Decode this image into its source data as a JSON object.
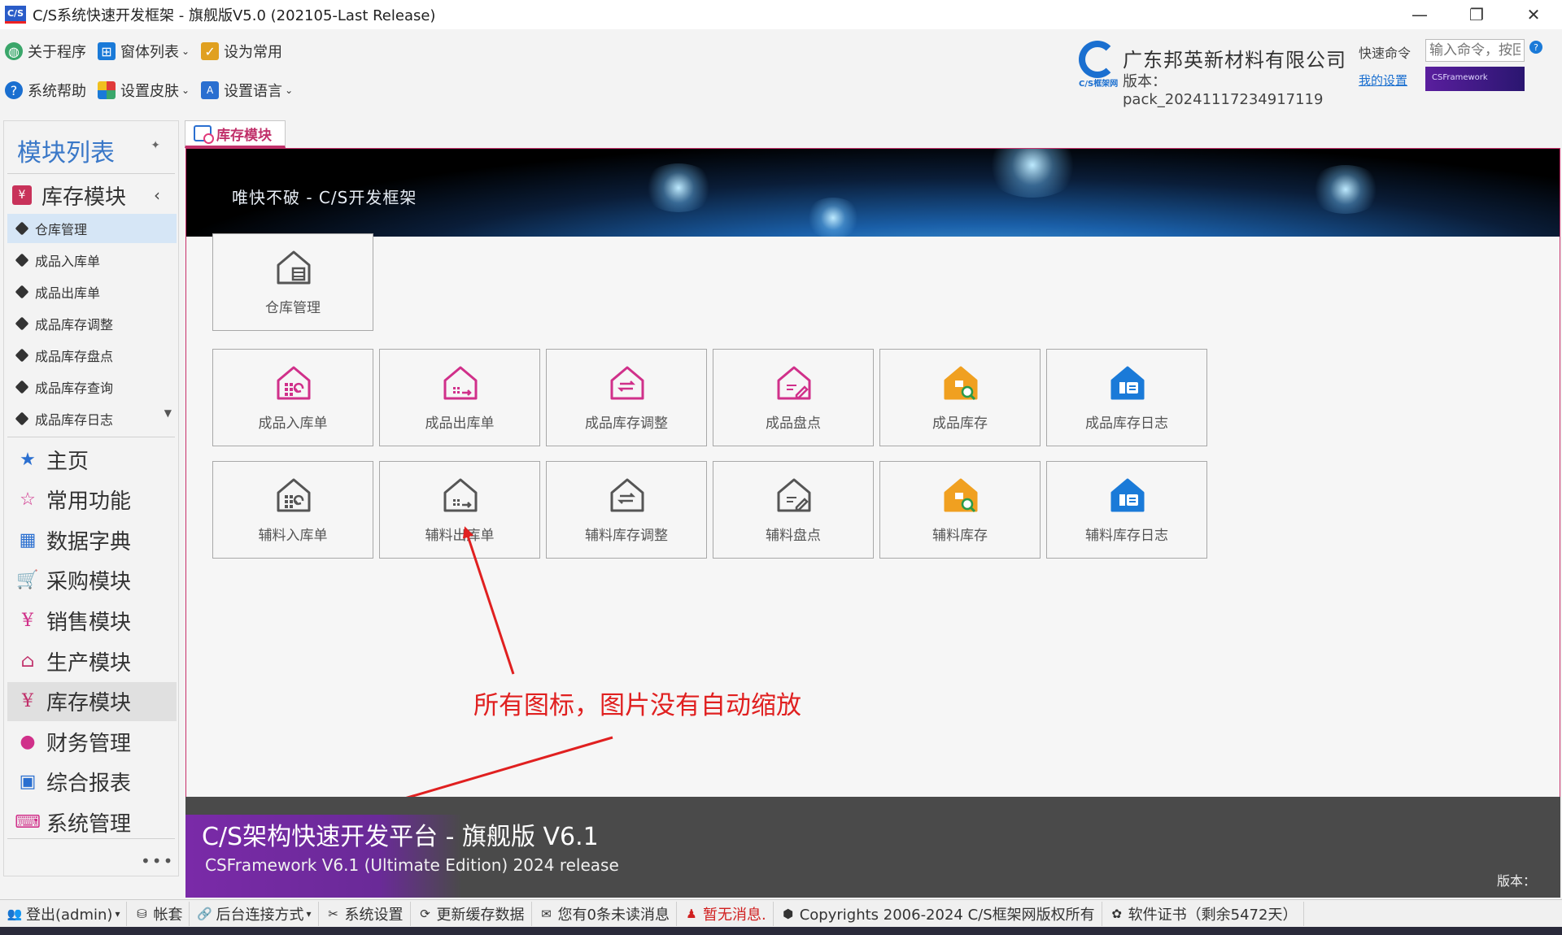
{
  "window": {
    "logo_text": "C/S",
    "title": "C/S系统快速开发框架 - 旗舰版V5.0 (202105-Last Release)",
    "buttons": [
      "—",
      "❐",
      "✕"
    ]
  },
  "toolbar": {
    "row1": [
      {
        "label": "关于程序",
        "icon": "globe-icon",
        "dropdown": false
      },
      {
        "label": "窗体列表",
        "icon": "windows-icon",
        "dropdown": true
      },
      {
        "label": "设为常用",
        "icon": "clipboard-icon",
        "dropdown": false
      }
    ],
    "row2": [
      {
        "label": "系统帮助",
        "icon": "help-icon",
        "dropdown": false
      },
      {
        "label": "设置皮肤",
        "icon": "palette-icon",
        "dropdown": true
      },
      {
        "label": "设置语言",
        "icon": "language-icon",
        "dropdown": true
      }
    ]
  },
  "company": {
    "logo_sub": "C/S框架网",
    "name": "广东邦英新材料有限公司",
    "version": "版本：pack_20241117234917119"
  },
  "quick": {
    "label": "快速命令",
    "placeholder": "输入命令，按回",
    "help": "?",
    "my_settings": "我的设置",
    "badge": "CSFramework"
  },
  "sidebar": {
    "title": "模块列表",
    "pin": "✦",
    "group": {
      "label": "库存模块",
      "arrow": "‹"
    },
    "sub_items": [
      {
        "label": "仓库管理",
        "active": true
      },
      {
        "label": "成品入库单",
        "active": false
      },
      {
        "label": "成品出库单",
        "active": false
      },
      {
        "label": "成品库存调整",
        "active": false
      },
      {
        "label": "成品库存盘点",
        "active": false
      },
      {
        "label": "成品库存查询",
        "active": false
      },
      {
        "label": "成品库存日志",
        "active": false
      }
    ],
    "modules": [
      {
        "label": "主页",
        "icon": "star-filled-icon",
        "glyph": "★",
        "color": "#2a6fd0",
        "active": false
      },
      {
        "label": "常用功能",
        "icon": "star-outline-icon",
        "glyph": "☆",
        "color": "#d0308a",
        "active": false
      },
      {
        "label": "数据字典",
        "icon": "dictionary-icon",
        "glyph": "▦",
        "color": "#2a6fd0",
        "active": false
      },
      {
        "label": "采购模块",
        "icon": "cart-icon",
        "glyph": "🛒",
        "color": "#d0308a",
        "active": false
      },
      {
        "label": "销售模块",
        "icon": "bag-icon",
        "glyph": "¥",
        "color": "#d0308a",
        "active": false
      },
      {
        "label": "生产模块",
        "icon": "factory-icon",
        "glyph": "⌂",
        "color": "#c0306a",
        "active": false
      },
      {
        "label": "库存模块",
        "icon": "inventory-icon",
        "glyph": "¥",
        "color": "#c0306a",
        "active": true
      },
      {
        "label": "财务管理",
        "icon": "user-icon",
        "glyph": "●",
        "color": "#d0308a",
        "active": false
      },
      {
        "label": "综合报表",
        "icon": "report-icon",
        "glyph": "▣",
        "color": "#2a6fd0",
        "active": false
      },
      {
        "label": "系统管理",
        "icon": "code-icon",
        "glyph": "⌨",
        "color": "#d0308a",
        "active": false
      }
    ],
    "more": "•••"
  },
  "tab": {
    "label": "库存模块"
  },
  "banner": {
    "text": "唯快不破 - C/S开发框架"
  },
  "tiles_row1": [
    {
      "label": "仓库管理",
      "icon": "warehouse-list-icon",
      "color": "#555555"
    }
  ],
  "tiles_row2": [
    {
      "label": "成品入库单",
      "icon": "warehouse-in-icon",
      "color": "#d0308a"
    },
    {
      "label": "成品出库单",
      "icon": "warehouse-out-icon",
      "color": "#d0308a"
    },
    {
      "label": "成品库存调整",
      "icon": "warehouse-adjust-icon",
      "color": "#d0308a"
    },
    {
      "label": "成品盘点",
      "icon": "warehouse-check-icon",
      "color": "#d0308a"
    },
    {
      "label": "成品库存",
      "icon": "warehouse-search-icon",
      "color": "#f0a020"
    },
    {
      "label": "成品库存日志",
      "icon": "warehouse-log-icon",
      "color": "#1a7ad8"
    }
  ],
  "tiles_row3": [
    {
      "label": "辅料入库单",
      "icon": "material-in-icon",
      "color": "#555555"
    },
    {
      "label": "辅料出库单",
      "icon": "material-out-icon",
      "color": "#555555"
    },
    {
      "label": "辅料库存调整",
      "icon": "material-adjust-icon",
      "color": "#555555"
    },
    {
      "label": "辅料盘点",
      "icon": "material-check-icon",
      "color": "#555555"
    },
    {
      "label": "辅料库存",
      "icon": "material-search-icon",
      "color": "#f0a020"
    },
    {
      "label": "辅料库存日志",
      "icon": "material-log-icon",
      "color": "#1a7ad8"
    }
  ],
  "annotation": {
    "text": "所有图标，图片没有自动缩放"
  },
  "footer": {
    "title": "C/S架构快速开发平台 - 旗舰版 V6.1",
    "subtitle": "CSFramework V6.1 (Ultimate Edition) 2024 release",
    "version_label": "版本："
  },
  "statusbar": [
    {
      "label": "登出(admin)",
      "icon": "users-icon",
      "glyph": "👥",
      "dropdown": true,
      "red": false
    },
    {
      "label": "帐套",
      "icon": "database-icon",
      "glyph": "⛁",
      "dropdown": false,
      "red": false
    },
    {
      "label": "后台连接方式",
      "icon": "link-icon",
      "glyph": "🔗",
      "dropdown": true,
      "red": false
    },
    {
      "label": "系统设置",
      "icon": "tools-icon",
      "glyph": "✂",
      "dropdown": false,
      "red": false
    },
    {
      "label": "更新缓存数据",
      "icon": "refresh-icon",
      "glyph": "⟳",
      "dropdown": false,
      "red": false
    },
    {
      "label": "您有0条未读消息",
      "icon": "mail-icon",
      "glyph": "✉",
      "dropdown": false,
      "red": false
    },
    {
      "label": "暂无消息.",
      "icon": "person-icon",
      "glyph": "♟",
      "dropdown": false,
      "red": true
    },
    {
      "label": "Copyrights 2006-2024 C/S框架网版权所有",
      "icon": "box-icon",
      "glyph": "⬢",
      "dropdown": false,
      "red": false
    },
    {
      "label": "软件证书（剩余5472天）",
      "icon": "certificate-icon",
      "glyph": "✿",
      "dropdown": false,
      "red": false
    }
  ]
}
